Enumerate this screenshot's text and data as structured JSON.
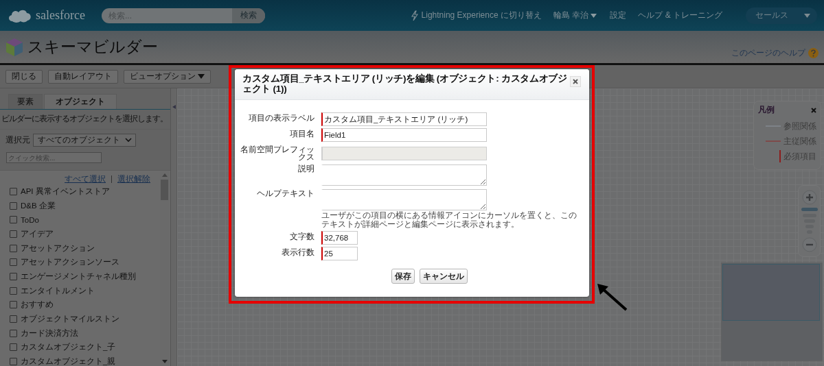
{
  "header": {
    "logo": "salesforce",
    "search": {
      "placeholder": "検索..."
    },
    "search_button": "検索",
    "nav": [
      "Lightning Experience に切り替え",
      "輪島 幸治",
      "設定",
      "ヘルプ & トレーニング"
    ],
    "app_menu": "セールス"
  },
  "page": {
    "title": "スキーマビルダー",
    "help_link": "このページのヘルプ"
  },
  "toolbar": [
    "閉じる",
    "自動レイアウト",
    "ビューオプション"
  ],
  "sidebar": {
    "tabs": [
      {
        "label": "要素",
        "selected": false
      },
      {
        "label": "オブジェクト",
        "selected": true
      }
    ],
    "hint": "ビルダーに表示するオブジェクトを選択します。",
    "select_label": "選択元",
    "select_value": "すべてのオブジェクト",
    "quick_search": {
      "placeholder": "クイック検索..."
    },
    "select_all": "すべて選択",
    "deselect": "選択解除",
    "objects": [
      {
        "label": "API 異常イベントストア",
        "checked": false
      },
      {
        "label": "D&B 企業",
        "checked": false
      },
      {
        "label": "ToDo",
        "checked": false
      },
      {
        "label": "アイデア",
        "checked": false
      },
      {
        "label": "アセットアクション",
        "checked": false
      },
      {
        "label": "アセットアクションソース",
        "checked": false
      },
      {
        "label": "エンゲージメントチャネル種別",
        "checked": false
      },
      {
        "label": "エンタイトルメント",
        "checked": false
      },
      {
        "label": "おすすめ",
        "checked": false
      },
      {
        "label": "オブジェクトマイルストン",
        "checked": false
      },
      {
        "label": "カード決済方法",
        "checked": false
      },
      {
        "label": "カスタムオブジェクト_子",
        "checked": false
      },
      {
        "label": "カスタムオブジェクト_親",
        "checked": false
      }
    ]
  },
  "legend": {
    "title": "凡例",
    "items": [
      {
        "label": "参照関係",
        "kind": "lookup"
      },
      {
        "label": "主従関係",
        "kind": "master"
      },
      {
        "label": "必須項目",
        "kind": "required"
      }
    ]
  },
  "dialog": {
    "title": "カスタム項目_テキストエリア (リッチ)を編集 (オブジェクト: カスタムオブジェクト (1))",
    "fields": [
      {
        "label": "項目の表示ラベル",
        "kind": "text",
        "value": "カスタム項目_テキストエリア (リッチ)",
        "required": true
      },
      {
        "label": "項目名",
        "kind": "text",
        "value": "Field1",
        "required": true
      },
      {
        "label": "名前空間プレフィックス",
        "kind": "disabled",
        "required": false
      },
      {
        "label": "説明",
        "kind": "textarea",
        "required": false
      },
      {
        "label": "ヘルプテキスト",
        "kind": "textarea",
        "required": false,
        "note": "ユーザがこの項目の横にある情報アイコンにカーソルを置くと、このテキストが詳細ページと編集ページに表示されます。"
      },
      {
        "label": "文字数",
        "kind": "short",
        "value": "32,768",
        "required": true
      },
      {
        "label": "表示行数",
        "kind": "short",
        "value": "25",
        "required": true
      }
    ],
    "buttons": [
      "保存",
      "キャンセル"
    ]
  }
}
